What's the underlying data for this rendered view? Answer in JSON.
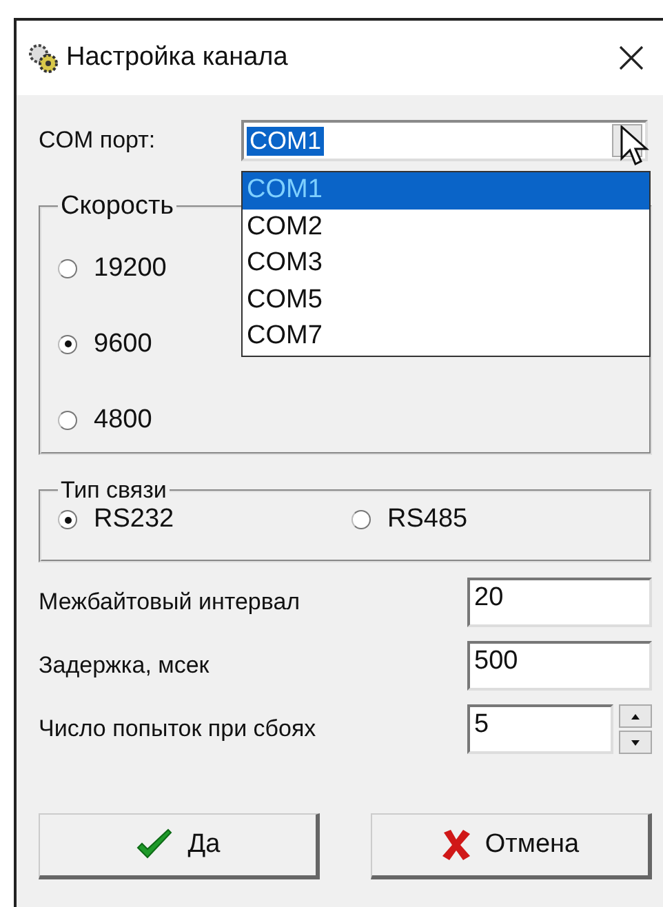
{
  "window": {
    "title": "Настройка канала"
  },
  "com_port": {
    "label": "COM порт:",
    "value": "COM1",
    "options": [
      {
        "label": "COM1",
        "selected": true
      },
      {
        "label": "COM2",
        "selected": false
      },
      {
        "label": "COM3",
        "selected": false
      },
      {
        "label": "COM5",
        "selected": false
      },
      {
        "label": "COM7",
        "selected": false
      }
    ]
  },
  "speed": {
    "title": "Скорость",
    "options": [
      {
        "label": "19200",
        "selected": false
      },
      {
        "label": "9600",
        "selected": true
      },
      {
        "label": "4800",
        "selected": false
      }
    ]
  },
  "connection_type": {
    "title": "Тип связи",
    "options": [
      {
        "label": "RS232",
        "selected": true
      },
      {
        "label": "RS485",
        "selected": false
      }
    ]
  },
  "fields": [
    {
      "label": "Межбайтовый интервал",
      "value": "20",
      "kind": "text"
    },
    {
      "label": "Задержка, мсек",
      "value": "500",
      "kind": "text"
    },
    {
      "label": "Число попыток при сбоях",
      "value": "5",
      "kind": "spin"
    }
  ],
  "buttons": [
    {
      "label": "Да",
      "kind": "ok"
    },
    {
      "label": "Отмена",
      "kind": "cancel"
    }
  ]
}
